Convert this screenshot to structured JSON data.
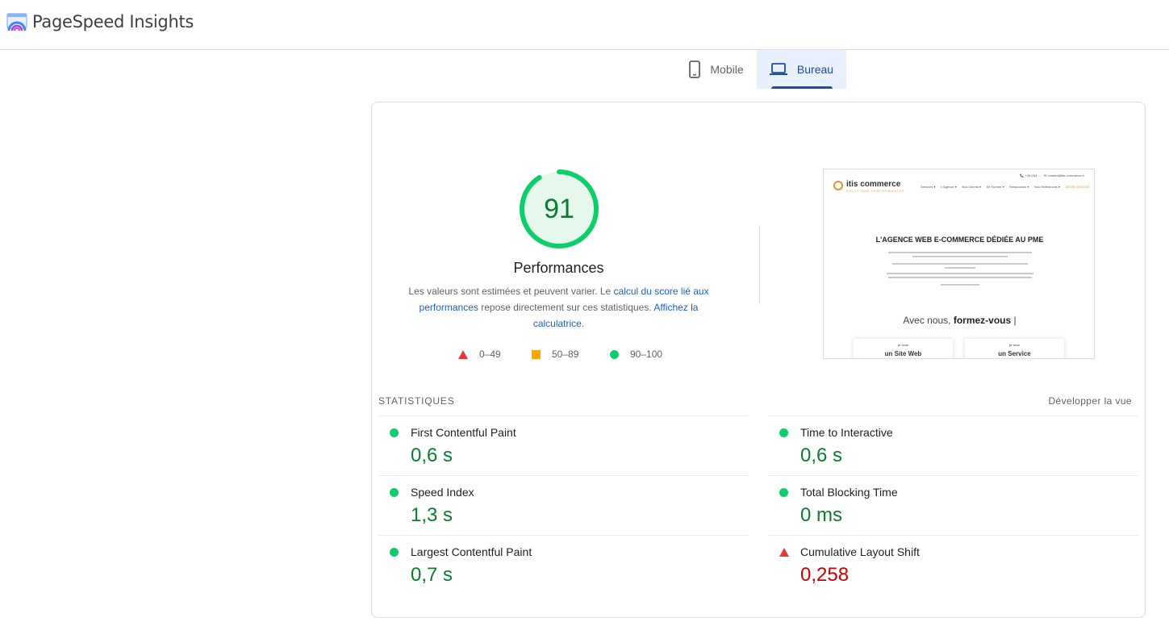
{
  "app": {
    "title": "PageSpeed Insights",
    "colors": {
      "accent": "#1a4ea6",
      "good": "#0cce6b",
      "average": "#ffa400",
      "poor": "#e53935"
    }
  },
  "tabs": [
    {
      "label": "Mobile",
      "icon": "phone-icon",
      "selected": false
    },
    {
      "label": "Bureau",
      "icon": "laptop-icon",
      "selected": true
    }
  ],
  "score": {
    "value": "91",
    "fraction": 0.91,
    "title": "Performances",
    "desc_part1": "Les valeurs sont estimées et peuvent varier. Le ",
    "desc_link1": "calcul du score lié aux performances",
    "desc_part2": " repose directement sur ces statistiques. ",
    "desc_link2": "Affichez la calculatrice",
    "desc_part3": "."
  },
  "legend": [
    {
      "range": "0–49",
      "icon": "triangle-red"
    },
    {
      "range": "50–89",
      "icon": "square-orange"
    },
    {
      "range": "90–100",
      "icon": "circle-green"
    }
  ],
  "thumbnail": {
    "contact": "📞 +33 (0)4 … · ✉ contact@itis-commerce.fr",
    "brand": "itis commerce",
    "tagline_small": "SOLUTIONS PERFORMANTES",
    "nav": [
      "Services ▾",
      "L'Agence ▾",
      "Nos Clients ▾",
      "Se Former ▾",
      "Ressources ▾",
      "Nos Références ▾",
      "DEVIS GRATUIT"
    ],
    "heading": "L'AGENCE WEB E-COMMERCE DÉDIÉE AU PME",
    "slogan_start": "Avec nous, ",
    "slogan_bold": "formez-vous",
    "box1_small": "je veux",
    "box1_big": "un Site Web",
    "box2_small": "je veux",
    "box2_big": "un Service"
  },
  "stats": {
    "label": "STATISTIQUES",
    "expand": "Développer la vue",
    "metrics": [
      {
        "name": "First Contentful Paint",
        "value": "0,6 s",
        "rating": "good"
      },
      {
        "name": "Time to Interactive",
        "value": "0,6 s",
        "rating": "good"
      },
      {
        "name": "Speed Index",
        "value": "1,3 s",
        "rating": "good"
      },
      {
        "name": "Total Blocking Time",
        "value": "0 ms",
        "rating": "good"
      },
      {
        "name": "Largest Contentful Paint",
        "value": "0,7 s",
        "rating": "good"
      },
      {
        "name": "Cumulative Layout Shift",
        "value": "0,258",
        "rating": "poor"
      }
    ]
  }
}
